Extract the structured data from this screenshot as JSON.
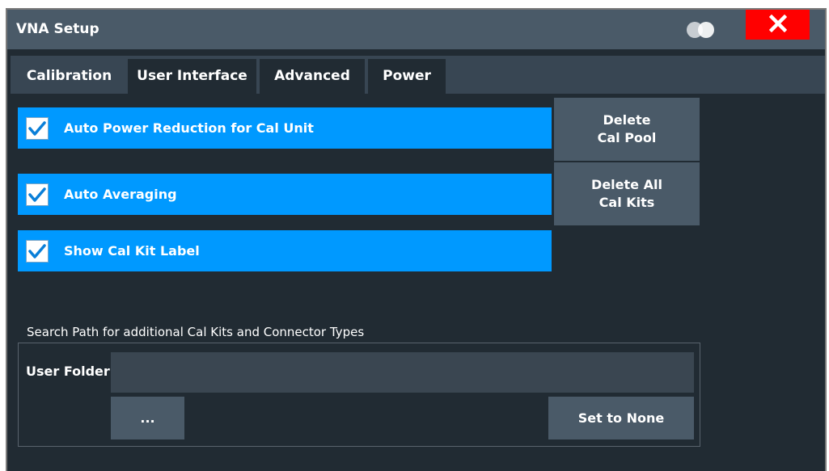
{
  "window": {
    "title": "VNA Setup"
  },
  "icons": {
    "toggle": "two-circles-toggle-icon",
    "close": "close-x-icon"
  },
  "colors": {
    "background": "#212b33",
    "titlebar": "#4a5a68",
    "checkbox_row": "#0099ff",
    "close_button": "#ff0000",
    "button": "#4a5a68"
  },
  "tabs": [
    {
      "label": "Calibration",
      "active": true
    },
    {
      "label": "User Interface",
      "active": false
    },
    {
      "label": "Advanced",
      "active": false
    },
    {
      "label": "Power",
      "active": false
    }
  ],
  "checkboxes": [
    {
      "label": "Auto Power Reduction for Cal Unit",
      "checked": true
    },
    {
      "label": "Auto Averaging",
      "checked": true
    },
    {
      "label": "Show Cal Kit Label",
      "checked": true
    }
  ],
  "buttons": {
    "delete_cal_pool": [
      "Delete",
      "Cal Pool"
    ],
    "delete_all_cal_kits": [
      "Delete All",
      "Cal Kits"
    ],
    "browse": "...",
    "set_to_none": "Set to None"
  },
  "search_path": {
    "section_label": "Search Path for additional Cal Kits and Connector Types",
    "folder_label": "User Folder",
    "folder_value": ""
  }
}
